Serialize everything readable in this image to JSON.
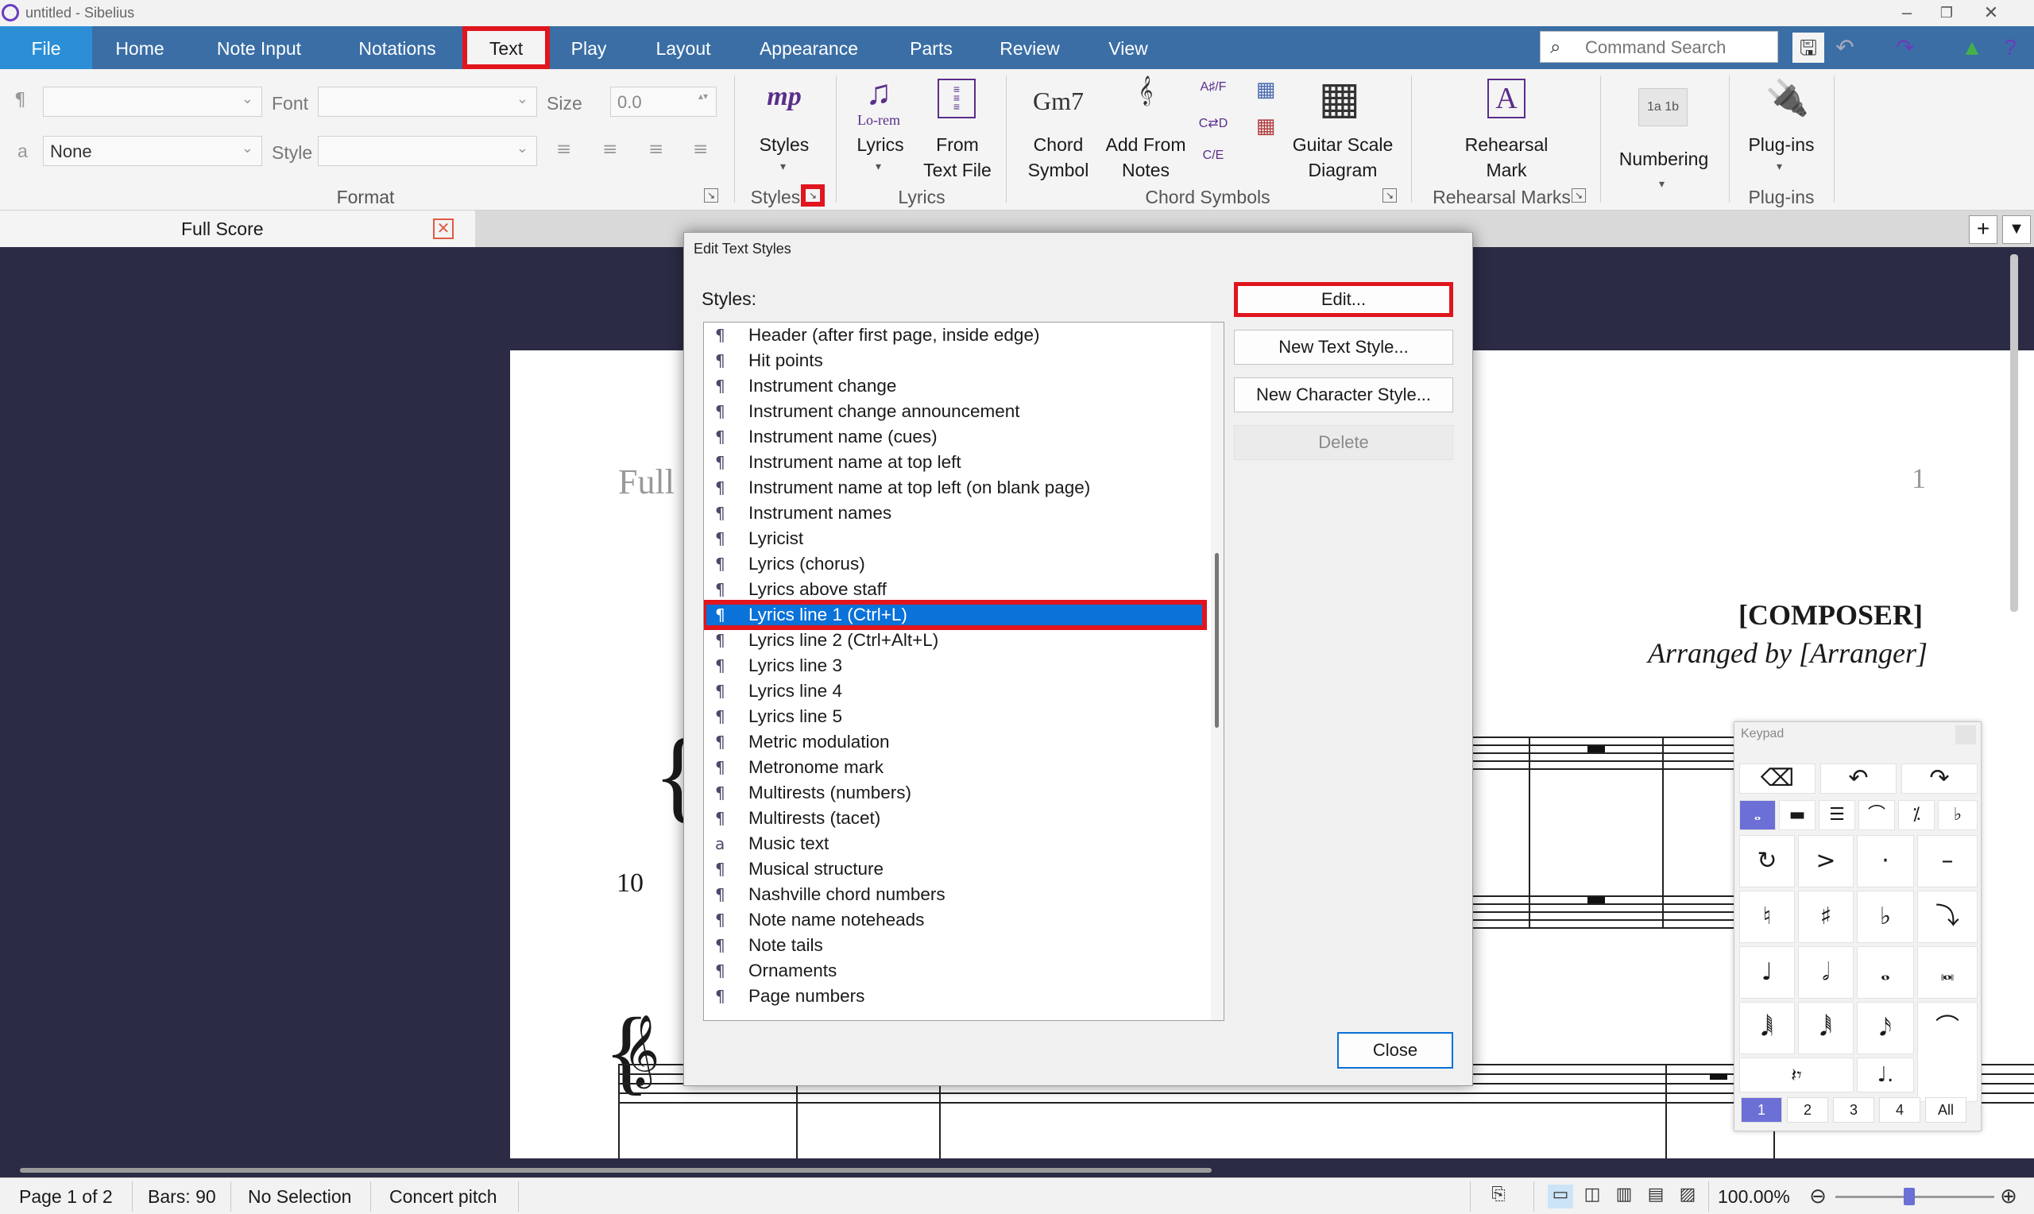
{
  "window": {
    "title": "untitled - Sibelius"
  },
  "tabs": [
    {
      "label": "File"
    },
    {
      "label": "Home"
    },
    {
      "label": "Note Input"
    },
    {
      "label": "Notations"
    },
    {
      "label": "Text"
    },
    {
      "label": "Play"
    },
    {
      "label": "Layout"
    },
    {
      "label": "Appearance"
    },
    {
      "label": "Parts"
    },
    {
      "label": "Review"
    },
    {
      "label": "View"
    }
  ],
  "command_search": {
    "placeholder": "Command Search"
  },
  "ribbon": {
    "format": {
      "font_label": "Font",
      "style_label": "Style",
      "size_label": "Size",
      "size_value": "0.0",
      "char_style_value": "None",
      "group_label": "Format"
    },
    "styles": {
      "label": "Styles",
      "group_label": "Styles",
      "icon_text": "mp"
    },
    "lyrics": {
      "lyrics_label": "Lyrics",
      "lyrics_icon_text": "Lo-rem",
      "from_text_file_line1": "From",
      "from_text_file_line2": "Text File",
      "group_label": "Lyrics"
    },
    "chord_symbols": {
      "chord_icon_text": "Gm7",
      "chord_symbol_line1": "Chord",
      "chord_symbol_line2": "Symbol",
      "add_from_notes_line1": "Add From",
      "add_from_notes_line2": "Notes",
      "guitar_line1": "Guitar Scale",
      "guitar_line2": "Diagram",
      "group_label": "Chord Symbols"
    },
    "rehearsal": {
      "line1": "Rehearsal",
      "line2": "Mark",
      "icon_text": "A",
      "group_label": "Rehearsal Marks"
    },
    "numbering": {
      "label": "Numbering"
    },
    "plugins": {
      "label": "Plug-ins",
      "group_label": "Plug-ins"
    }
  },
  "document_tab": {
    "label": "Full Score"
  },
  "score": {
    "title_partial": "Full",
    "page_number": "1",
    "composer": "[COMPOSER]",
    "arranger": "Arranged by [Arranger]",
    "bar_number": "10"
  },
  "dialog": {
    "title": "Edit Text Styles",
    "styles_label": "Styles:",
    "styles": [
      {
        "name": "Header (after first page, inside edge)",
        "type": "paragraph"
      },
      {
        "name": "Hit points",
        "type": "paragraph"
      },
      {
        "name": "Instrument change",
        "type": "paragraph"
      },
      {
        "name": "Instrument change announcement",
        "type": "paragraph"
      },
      {
        "name": "Instrument name (cues)",
        "type": "paragraph"
      },
      {
        "name": "Instrument name at top left",
        "type": "paragraph"
      },
      {
        "name": "Instrument name at top left (on blank page)",
        "type": "paragraph"
      },
      {
        "name": "Instrument names",
        "type": "paragraph"
      },
      {
        "name": "Lyricist",
        "type": "paragraph"
      },
      {
        "name": "Lyrics (chorus)",
        "type": "paragraph"
      },
      {
        "name": "Lyrics above staff",
        "type": "paragraph"
      },
      {
        "name": "Lyrics line 1 (Ctrl+L)",
        "type": "paragraph",
        "selected": true
      },
      {
        "name": "Lyrics line 2 (Ctrl+Alt+L)",
        "type": "paragraph"
      },
      {
        "name": "Lyrics line 3",
        "type": "paragraph"
      },
      {
        "name": "Lyrics line 4",
        "type": "paragraph"
      },
      {
        "name": "Lyrics line 5",
        "type": "paragraph"
      },
      {
        "name": "Metric modulation",
        "type": "paragraph"
      },
      {
        "name": "Metronome mark",
        "type": "paragraph"
      },
      {
        "name": "Multirests (numbers)",
        "type": "paragraph"
      },
      {
        "name": "Multirests (tacet)",
        "type": "paragraph"
      },
      {
        "name": "Music text",
        "type": "character"
      },
      {
        "name": "Musical structure",
        "type": "paragraph"
      },
      {
        "name": "Nashville chord numbers",
        "type": "paragraph"
      },
      {
        "name": "Note name noteheads",
        "type": "paragraph"
      },
      {
        "name": "Note tails",
        "type": "paragraph"
      },
      {
        "name": "Ornaments",
        "type": "paragraph"
      },
      {
        "name": "Page numbers",
        "type": "paragraph"
      }
    ],
    "buttons": {
      "edit": "Edit...",
      "new_text_style": "New Text Style...",
      "new_character_style": "New Character Style...",
      "delete": "Delete",
      "close": "Close"
    }
  },
  "keypad": {
    "title": "Keypad",
    "layouts": [
      "1",
      "2",
      "3",
      "4",
      "All"
    ],
    "active_layout": "1"
  },
  "statusbar": {
    "page": "Page 1 of 2",
    "bars": "Bars: 90",
    "selection": "No Selection",
    "pitch": "Concert pitch",
    "zoom": "100.00%"
  },
  "colors": {
    "tab_bar": "#3a6ea5",
    "file_tab": "#2c8fd6",
    "highlight_box": "#e0151d",
    "selection": "#0a72d8",
    "score_background": "#2b2b45",
    "keypad_active": "#6b6fd6"
  }
}
